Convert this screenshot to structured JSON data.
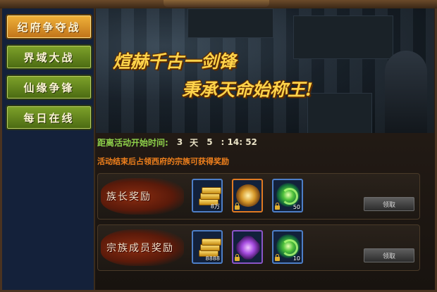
{
  "nav": [
    {
      "label": "纪府争夺战",
      "active": true
    },
    {
      "label": "界域大战",
      "active": false
    },
    {
      "label": "仙缘争锋",
      "active": false
    },
    {
      "label": "每日在线",
      "active": false
    }
  ],
  "banner": {
    "line1": "煊赫千古一剑锋",
    "line2": "秉承天命始称王!"
  },
  "countdown": {
    "label": "距离活动开始时间:",
    "days": "3",
    "days_unit": "天",
    "hours": "5",
    "minutes_seconds": ": 14: 52"
  },
  "notice": "活动结束后占领西府的宗族可获得奖励",
  "rewards": [
    {
      "title": "族长奖励",
      "claim_label": "领取",
      "items": [
        {
          "icon": "gold-bars-icon",
          "frame": "blue",
          "qty": "8万",
          "locked": false
        },
        {
          "icon": "treasure-pile-icon",
          "frame": "orange",
          "qty": "",
          "locked": true
        },
        {
          "icon": "green-orb-icon",
          "frame": "blue",
          "qty": "50",
          "locked": true
        }
      ]
    },
    {
      "title": "宗族成员奖励",
      "claim_label": "领取",
      "items": [
        {
          "icon": "gold-bars-icon",
          "frame": "blue",
          "qty": "8888",
          "locked": false
        },
        {
          "icon": "purple-crystal-icon",
          "frame": "purple",
          "qty": "",
          "locked": true
        },
        {
          "icon": "green-orb-icon",
          "frame": "blue",
          "qty": "10",
          "locked": true
        }
      ]
    }
  ],
  "colors": {
    "nav_active": "#e49a2c",
    "nav_inactive": "#6a8e22",
    "countdown_label": "#8ed14a",
    "notice": "#f0801c",
    "slogan": "#ffd34a"
  }
}
